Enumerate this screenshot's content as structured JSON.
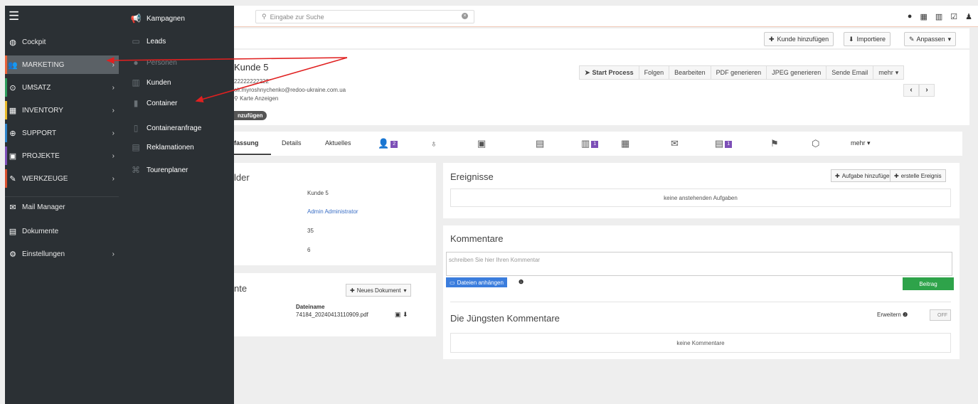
{
  "sidebar": {
    "items": [
      {
        "label": "Cockpit",
        "icon": "dashboard-icon"
      },
      {
        "label": "MARKETING",
        "icon": "users-icon",
        "accent": "#e8623a"
      },
      {
        "label": "UMSATZ",
        "icon": "target-icon",
        "accent": "#2e9b5b"
      },
      {
        "label": "INVENTORY",
        "icon": "inventory-icon",
        "accent": "#e8b92a"
      },
      {
        "label": "SUPPORT",
        "icon": "lifebuoy-icon",
        "accent": "#2d82c8"
      },
      {
        "label": "PROJEKTE",
        "icon": "briefcase-icon",
        "accent": "#7d4fb7"
      },
      {
        "label": "WERKZEUGE",
        "icon": "wrench-icon",
        "accent": "#d8502f"
      },
      {
        "label": "Mail Manager",
        "icon": "mail-manager-icon"
      },
      {
        "label": "Dokumente",
        "icon": "document-icon"
      },
      {
        "label": "Einstellungen",
        "icon": "gear-icon"
      }
    ],
    "submenu": [
      {
        "label": "Kampagnen",
        "icon": "megaphone-icon"
      },
      {
        "label": "Leads",
        "icon": "id-card-icon"
      },
      {
        "label": "Personen",
        "icon": "person-icon"
      },
      {
        "label": "Kunden",
        "icon": "building-icon"
      },
      {
        "label": "Container",
        "icon": "container-icon"
      },
      {
        "label": "Containeranfrage",
        "icon": "request-icon"
      },
      {
        "label": "Reklamationen",
        "icon": "complaint-icon"
      },
      {
        "label": "Tourenplaner",
        "icon": "route-icon"
      }
    ]
  },
  "topbar": {
    "search_placeholder": "Eingabe zur Suche",
    "icons": [
      "circle-icon",
      "calendar-icon",
      "chart-icon",
      "checkbox-icon",
      "user-icon"
    ]
  },
  "toolbar": {
    "add_customer": "Kunde hinzufügen",
    "import": "Importiere",
    "customize": "Anpassen"
  },
  "record": {
    "title": "Kunde 5",
    "phone": "22222222222",
    "email": "olr.myroshnychenko@redoo-ukraine.com.ua",
    "card_link": "Karte Anzeigen",
    "tag_add": "nzufügen",
    "actions": [
      "Start Process",
      "Folgen",
      "Bearbeiten",
      "PDF generieren",
      "JPEG generieren",
      "Sende Email",
      "mehr"
    ]
  },
  "tabs": {
    "items": [
      "fassung",
      "Details",
      "Aktuelles"
    ],
    "counts": [
      "2",
      "1",
      "1"
    ],
    "more": "mehr"
  },
  "fields_panel": {
    "title": "lder",
    "values": [
      "Kunde 5",
      "Admin Administrator",
      "35",
      "6"
    ]
  },
  "docs_panel": {
    "title": "nte",
    "new_doc": "Neues Dokument",
    "col_header": "Dateiname",
    "file": "74184_20240413110909.pdf"
  },
  "events_panel": {
    "title": "Ereignisse",
    "add_task": "Aufgabe hinzufügen",
    "create_event": "erstelle Ereignis",
    "empty": "keine anstehenden Aufgaben"
  },
  "comments_panel": {
    "title": "Kommentare",
    "placeholder": "schreiben Sie hier Ihren Kommentar",
    "attach": "Dateien anhängen",
    "post": "Beitrag",
    "recent_title": "Die Jüngsten Kommentare",
    "expand": "Erweitern",
    "toggle": "OFF",
    "empty": "keine Kommentare"
  },
  "colors": {
    "sidebar_bg": "#2b3034",
    "arrow": "#e02020",
    "count_badge": "#7d4fb7",
    "post_button": "#2ea34a",
    "attach_button": "#3b7ddd"
  }
}
